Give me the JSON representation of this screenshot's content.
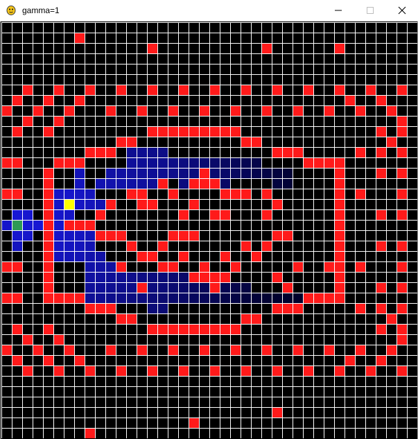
{
  "window": {
    "title": "gamma=1",
    "icons": {
      "app": "python-snake-icon",
      "minimize": "minimize-icon",
      "maximize": "maximize-icon",
      "close": "close-icon"
    }
  },
  "grid": {
    "columns": 40,
    "rows": 40,
    "colors": {
      "background": "#000000",
      "grid_lines": "#ffffff",
      "obstacle": "#ff1a1a",
      "start": "#2e9a55",
      "agent": "#ffff00"
    },
    "start_cell": [
      1,
      19
    ],
    "agent_cell": [
      6,
      17
    ],
    "obstacles": [
      [
        7,
        1
      ],
      [
        14,
        2
      ],
      [
        32,
        2
      ],
      [
        25,
        2
      ],
      [
        2,
        6
      ],
      [
        5,
        6
      ],
      [
        8,
        6
      ],
      [
        11,
        6
      ],
      [
        14,
        6
      ],
      [
        17,
        6
      ],
      [
        20,
        6
      ],
      [
        23,
        6
      ],
      [
        26,
        6
      ],
      [
        29,
        6
      ],
      [
        32,
        6
      ],
      [
        35,
        6
      ],
      [
        38,
        6
      ],
      [
        1,
        7
      ],
      [
        4,
        7
      ],
      [
        7,
        7
      ],
      [
        36,
        7
      ],
      [
        33,
        7
      ],
      [
        0,
        8
      ],
      [
        3,
        8
      ],
      [
        6,
        8
      ],
      [
        10,
        8
      ],
      [
        13,
        8
      ],
      [
        16,
        8
      ],
      [
        19,
        8
      ],
      [
        22,
        8
      ],
      [
        25,
        8
      ],
      [
        28,
        8
      ],
      [
        31,
        8
      ],
      [
        34,
        8
      ],
      [
        37,
        8
      ],
      [
        2,
        9
      ],
      [
        5,
        9
      ],
      [
        38,
        9
      ],
      [
        1,
        10
      ],
      [
        4,
        10
      ],
      [
        14,
        10
      ],
      [
        15,
        10
      ],
      [
        16,
        10
      ],
      [
        17,
        10
      ],
      [
        18,
        10
      ],
      [
        19,
        10
      ],
      [
        20,
        10
      ],
      [
        21,
        10
      ],
      [
        22,
        10
      ],
      [
        36,
        10
      ],
      [
        38,
        10
      ],
      [
        11,
        11
      ],
      [
        12,
        11
      ],
      [
        23,
        11
      ],
      [
        24,
        11
      ],
      [
        37,
        11
      ],
      [
        8,
        12
      ],
      [
        9,
        12
      ],
      [
        10,
        12
      ],
      [
        26,
        12
      ],
      [
        27,
        12
      ],
      [
        28,
        12
      ],
      [
        34,
        12
      ],
      [
        36,
        12
      ],
      [
        38,
        12
      ],
      [
        0,
        13
      ],
      [
        1,
        13
      ],
      [
        5,
        13
      ],
      [
        6,
        13
      ],
      [
        7,
        13
      ],
      [
        29,
        13
      ],
      [
        30,
        13
      ],
      [
        31,
        13
      ],
      [
        32,
        13
      ],
      [
        4,
        14
      ],
      [
        19,
        14
      ],
      [
        32,
        14
      ],
      [
        36,
        14
      ],
      [
        38,
        14
      ],
      [
        4,
        15
      ],
      [
        15,
        15
      ],
      [
        18,
        15
      ],
      [
        19,
        15
      ],
      [
        20,
        15
      ],
      [
        32,
        15
      ],
      [
        0,
        16
      ],
      [
        1,
        16
      ],
      [
        4,
        16
      ],
      [
        12,
        16
      ],
      [
        13,
        16
      ],
      [
        16,
        16
      ],
      [
        21,
        16
      ],
      [
        22,
        16
      ],
      [
        23,
        16
      ],
      [
        25,
        16
      ],
      [
        32,
        16
      ],
      [
        34,
        16
      ],
      [
        38,
        16
      ],
      [
        4,
        17
      ],
      [
        10,
        17
      ],
      [
        13,
        17
      ],
      [
        14,
        17
      ],
      [
        18,
        17
      ],
      [
        26,
        17
      ],
      [
        32,
        17
      ],
      [
        4,
        18
      ],
      [
        9,
        18
      ],
      [
        17,
        18
      ],
      [
        20,
        18
      ],
      [
        21,
        18
      ],
      [
        25,
        18
      ],
      [
        32,
        18
      ],
      [
        36,
        18
      ],
      [
        38,
        18
      ],
      [
        4,
        19
      ],
      [
        6,
        19
      ],
      [
        7,
        19
      ],
      [
        8,
        19
      ],
      [
        32,
        19
      ],
      [
        4,
        20
      ],
      [
        9,
        20
      ],
      [
        10,
        20
      ],
      [
        11,
        20
      ],
      [
        16,
        20
      ],
      [
        17,
        20
      ],
      [
        18,
        20
      ],
      [
        26,
        20
      ],
      [
        27,
        20
      ],
      [
        32,
        20
      ],
      [
        4,
        21
      ],
      [
        12,
        21
      ],
      [
        15,
        21
      ],
      [
        23,
        21
      ],
      [
        25,
        21
      ],
      [
        32,
        21
      ],
      [
        36,
        21
      ],
      [
        38,
        21
      ],
      [
        4,
        22
      ],
      [
        13,
        22
      ],
      [
        14,
        22
      ],
      [
        17,
        22
      ],
      [
        21,
        22
      ],
      [
        24,
        22
      ],
      [
        32,
        22
      ],
      [
        0,
        23
      ],
      [
        1,
        23
      ],
      [
        4,
        23
      ],
      [
        11,
        23
      ],
      [
        15,
        23
      ],
      [
        16,
        23
      ],
      [
        19,
        23
      ],
      [
        22,
        23
      ],
      [
        28,
        23
      ],
      [
        31,
        23
      ],
      [
        32,
        23
      ],
      [
        34,
        23
      ],
      [
        38,
        23
      ],
      [
        4,
        24
      ],
      [
        18,
        24
      ],
      [
        19,
        24
      ],
      [
        20,
        24
      ],
      [
        21,
        24
      ],
      [
        26,
        24
      ],
      [
        32,
        24
      ],
      [
        4,
        25
      ],
      [
        13,
        25
      ],
      [
        20,
        25
      ],
      [
        27,
        25
      ],
      [
        32,
        25
      ],
      [
        36,
        25
      ],
      [
        38,
        25
      ],
      [
        0,
        26
      ],
      [
        1,
        26
      ],
      [
        4,
        26
      ],
      [
        5,
        26
      ],
      [
        6,
        26
      ],
      [
        7,
        26
      ],
      [
        29,
        26
      ],
      [
        30,
        26
      ],
      [
        31,
        26
      ],
      [
        32,
        26
      ],
      [
        8,
        27
      ],
      [
        9,
        27
      ],
      [
        10,
        27
      ],
      [
        26,
        27
      ],
      [
        27,
        27
      ],
      [
        28,
        27
      ],
      [
        34,
        27
      ],
      [
        36,
        27
      ],
      [
        38,
        27
      ],
      [
        11,
        28
      ],
      [
        12,
        28
      ],
      [
        23,
        28
      ],
      [
        24,
        28
      ],
      [
        37,
        28
      ],
      [
        1,
        29
      ],
      [
        4,
        29
      ],
      [
        14,
        29
      ],
      [
        15,
        29
      ],
      [
        16,
        29
      ],
      [
        17,
        29
      ],
      [
        18,
        29
      ],
      [
        19,
        29
      ],
      [
        20,
        29
      ],
      [
        21,
        29
      ],
      [
        22,
        29
      ],
      [
        36,
        29
      ],
      [
        38,
        29
      ],
      [
        2,
        30
      ],
      [
        5,
        30
      ],
      [
        38,
        30
      ],
      [
        0,
        31
      ],
      [
        3,
        31
      ],
      [
        6,
        31
      ],
      [
        10,
        31
      ],
      [
        13,
        31
      ],
      [
        16,
        31
      ],
      [
        19,
        31
      ],
      [
        22,
        31
      ],
      [
        25,
        31
      ],
      [
        28,
        31
      ],
      [
        31,
        31
      ],
      [
        34,
        31
      ],
      [
        37,
        31
      ],
      [
        1,
        32
      ],
      [
        4,
        32
      ],
      [
        7,
        32
      ],
      [
        36,
        32
      ],
      [
        33,
        32
      ],
      [
        2,
        33
      ],
      [
        5,
        33
      ],
      [
        8,
        33
      ],
      [
        11,
        33
      ],
      [
        14,
        33
      ],
      [
        17,
        33
      ],
      [
        20,
        33
      ],
      [
        23,
        33
      ],
      [
        26,
        33
      ],
      [
        29,
        33
      ],
      [
        32,
        33
      ],
      [
        35,
        33
      ],
      [
        38,
        33
      ],
      [
        26,
        37
      ],
      [
        18,
        38
      ],
      [
        8,
        39
      ]
    ],
    "value_cells": [
      [
        12,
        12,
        0.55
      ],
      [
        13,
        12,
        0.55
      ],
      [
        14,
        12,
        0.52
      ],
      [
        15,
        12,
        0.5
      ],
      [
        12,
        13,
        0.6
      ],
      [
        13,
        13,
        0.58
      ],
      [
        14,
        13,
        0.56
      ],
      [
        15,
        13,
        0.54
      ],
      [
        16,
        13,
        0.5
      ],
      [
        17,
        13,
        0.46
      ],
      [
        18,
        13,
        0.42
      ],
      [
        19,
        13,
        0.38
      ],
      [
        20,
        13,
        0.34
      ],
      [
        21,
        13,
        0.3
      ],
      [
        22,
        13,
        0.26
      ],
      [
        23,
        13,
        0.22
      ],
      [
        24,
        13,
        0.18
      ],
      [
        7,
        14,
        0.75
      ],
      [
        10,
        14,
        0.66
      ],
      [
        11,
        14,
        0.64
      ],
      [
        12,
        14,
        0.62
      ],
      [
        13,
        14,
        0.6
      ],
      [
        14,
        14,
        0.58
      ],
      [
        15,
        14,
        0.55
      ],
      [
        16,
        14,
        0.52
      ],
      [
        17,
        14,
        0.48
      ],
      [
        18,
        14,
        0.44
      ],
      [
        20,
        14,
        0.38
      ],
      [
        21,
        14,
        0.34
      ],
      [
        22,
        14,
        0.3
      ],
      [
        23,
        14,
        0.25
      ],
      [
        24,
        14,
        0.2
      ],
      [
        25,
        14,
        0.16
      ],
      [
        26,
        14,
        0.12
      ],
      [
        27,
        14,
        0.08
      ],
      [
        7,
        15,
        0.78
      ],
      [
        9,
        15,
        0.72
      ],
      [
        10,
        15,
        0.7
      ],
      [
        11,
        15,
        0.68
      ],
      [
        12,
        15,
        0.65
      ],
      [
        13,
        15,
        0.62
      ],
      [
        14,
        15,
        0.58
      ],
      [
        15,
        15,
        0.55
      ],
      [
        17,
        15,
        0.45
      ],
      [
        21,
        15,
        0.32
      ],
      [
        26,
        15,
        0.12
      ],
      [
        27,
        15,
        0.08
      ],
      [
        5,
        16,
        0.82
      ],
      [
        6,
        16,
        0.85
      ],
      [
        7,
        16,
        0.82
      ],
      [
        8,
        16,
        0.78
      ],
      [
        5,
        17,
        0.82
      ],
      [
        7,
        17,
        0.82
      ],
      [
        8,
        17,
        0.78
      ],
      [
        9,
        17,
        0.72
      ],
      [
        1,
        18,
        0.9
      ],
      [
        2,
        18,
        0.88
      ],
      [
        5,
        18,
        0.85
      ],
      [
        6,
        18,
        0.82
      ],
      [
        0,
        19,
        0.85
      ],
      [
        2,
        19,
        0.9
      ],
      [
        3,
        19,
        0.9
      ],
      [
        5,
        19,
        0.86
      ],
      [
        1,
        20,
        0.88
      ],
      [
        2,
        20,
        0.86
      ],
      [
        5,
        20,
        0.84
      ],
      [
        6,
        20,
        0.82
      ],
      [
        7,
        20,
        0.8
      ],
      [
        8,
        20,
        0.75
      ],
      [
        1,
        21,
        0.8
      ],
      [
        5,
        21,
        0.82
      ],
      [
        6,
        21,
        0.8
      ],
      [
        7,
        21,
        0.78
      ],
      [
        8,
        21,
        0.72
      ],
      [
        5,
        22,
        0.78
      ],
      [
        6,
        22,
        0.76
      ],
      [
        7,
        22,
        0.74
      ],
      [
        8,
        22,
        0.7
      ],
      [
        9,
        22,
        0.66
      ],
      [
        8,
        23,
        0.68
      ],
      [
        9,
        23,
        0.66
      ],
      [
        10,
        23,
        0.62
      ],
      [
        8,
        24,
        0.64
      ],
      [
        9,
        24,
        0.62
      ],
      [
        10,
        24,
        0.58
      ],
      [
        11,
        24,
        0.55
      ],
      [
        12,
        24,
        0.52
      ],
      [
        13,
        24,
        0.48
      ],
      [
        14,
        24,
        0.45
      ],
      [
        15,
        24,
        0.42
      ],
      [
        16,
        24,
        0.38
      ],
      [
        17,
        24,
        0.34
      ],
      [
        8,
        25,
        0.6
      ],
      [
        9,
        25,
        0.58
      ],
      [
        10,
        25,
        0.55
      ],
      [
        11,
        25,
        0.52
      ],
      [
        12,
        25,
        0.5
      ],
      [
        14,
        25,
        0.45
      ],
      [
        15,
        25,
        0.42
      ],
      [
        16,
        25,
        0.38
      ],
      [
        17,
        25,
        0.34
      ],
      [
        18,
        25,
        0.3
      ],
      [
        19,
        25,
        0.26
      ],
      [
        21,
        25,
        0.22
      ],
      [
        22,
        25,
        0.18
      ],
      [
        23,
        25,
        0.14
      ],
      [
        8,
        26,
        0.58
      ],
      [
        9,
        26,
        0.56
      ],
      [
        10,
        26,
        0.52
      ],
      [
        11,
        26,
        0.5
      ],
      [
        12,
        26,
        0.46
      ],
      [
        13,
        26,
        0.44
      ],
      [
        14,
        26,
        0.42
      ],
      [
        15,
        26,
        0.38
      ],
      [
        16,
        26,
        0.35
      ],
      [
        17,
        26,
        0.32
      ],
      [
        18,
        26,
        0.28
      ],
      [
        19,
        26,
        0.25
      ],
      [
        20,
        26,
        0.22
      ],
      [
        21,
        26,
        0.18
      ],
      [
        22,
        26,
        0.15
      ],
      [
        23,
        26,
        0.12
      ],
      [
        24,
        26,
        0.09
      ],
      [
        25,
        26,
        0.06
      ],
      [
        26,
        26,
        0.04
      ],
      [
        27,
        26,
        0.03
      ],
      [
        28,
        26,
        0.02
      ],
      [
        14,
        27,
        0.42
      ],
      [
        15,
        27,
        0.4
      ]
    ]
  }
}
